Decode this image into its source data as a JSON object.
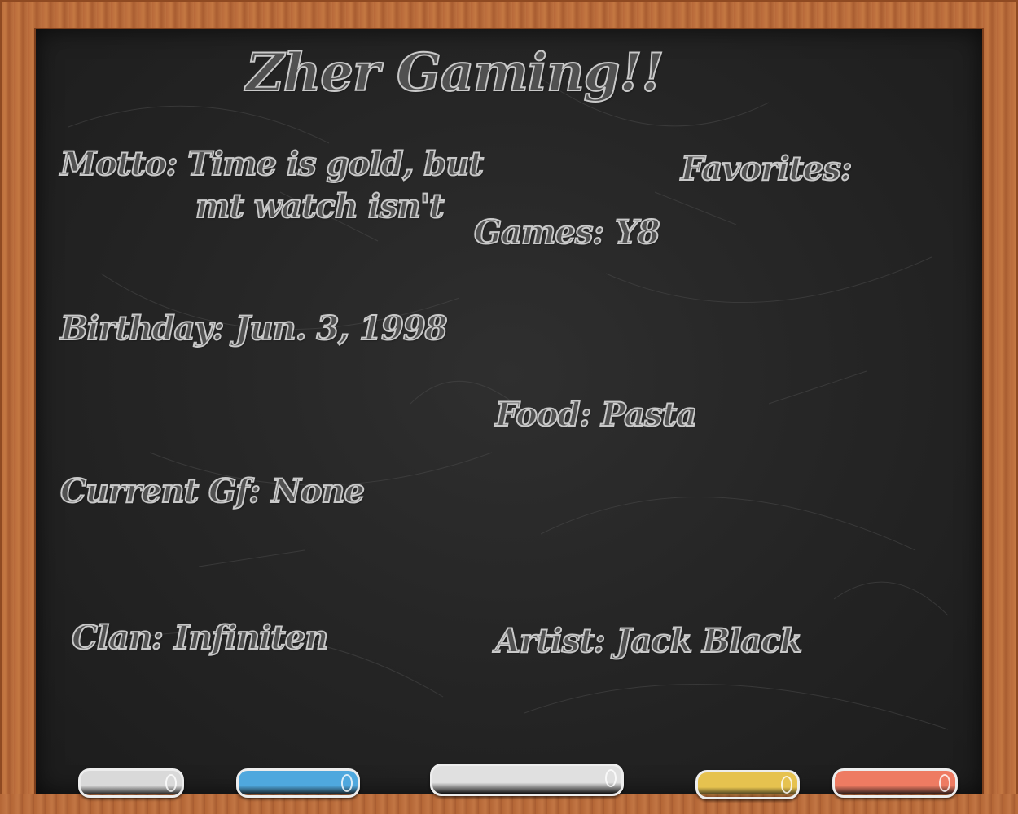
{
  "title": "Zher Gaming!!",
  "motto": {
    "label": "Motto:",
    "line1": "Time is gold, but",
    "line2": "mt watch isn't"
  },
  "favorites": {
    "label": "Favorites:"
  },
  "games": {
    "label": "Games:",
    "value": "Y8"
  },
  "birthday": {
    "label": "Birthday:",
    "value": "Jun. 3, 1998"
  },
  "food": {
    "label": "Food:",
    "value": "Pasta"
  },
  "girlfriend": {
    "label": "Current Gf:",
    "value": "None"
  },
  "clan": {
    "label": "Clan:",
    "value": "Infiniten"
  },
  "artist": {
    "label": "Artist:",
    "value": "Jack Black"
  },
  "chalks": [
    {
      "color": "#d9d9d9",
      "name": "white-chalk"
    },
    {
      "color": "#4fa8de",
      "name": "blue-chalk"
    },
    {
      "color": "#e0e0e0",
      "name": "white-chalk-large"
    },
    {
      "color": "#e6c24f",
      "name": "yellow-chalk"
    },
    {
      "color": "#ee7b62",
      "name": "red-chalk"
    }
  ]
}
